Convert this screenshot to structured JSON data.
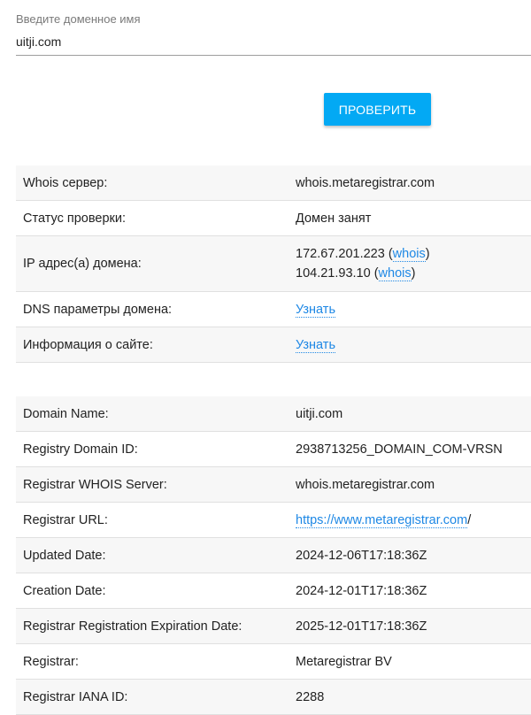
{
  "search": {
    "label": "Введите доменное имя",
    "value": "uitji.com",
    "button": "ПРОВЕРИТЬ"
  },
  "summary": {
    "whois_server_label": "Whois сервер:",
    "whois_server_value": "whois.metaregistrar.com",
    "status_label": "Статус проверки:",
    "status_value": "Домен занят",
    "ip_label": "IP адрес(а) домена:",
    "ips": [
      {
        "ip": "172.67.201.223",
        "link": "whois"
      },
      {
        "ip": "104.21.93.10",
        "link": "whois"
      }
    ],
    "dns_label": "DNS параметры домена:",
    "dns_link": "Узнать",
    "site_label": "Информация о сайте:",
    "site_link": "Узнать"
  },
  "whois": [
    {
      "key": "Domain Name:",
      "value": "uitji.com"
    },
    {
      "key": "Registry Domain ID:",
      "value": "2938713256_DOMAIN_COM-VRSN"
    },
    {
      "key": "Registrar WHOIS Server:",
      "value": "whois.metaregistrar.com"
    },
    {
      "key": "Registrar URL:",
      "value_link": "https://www.metaregistrar.com",
      "value_suffix": "/"
    },
    {
      "key": "Updated Date:",
      "value": "2024-12-06T17:18:36Z"
    },
    {
      "key": "Creation Date:",
      "value": "2024-12-01T17:18:36Z"
    },
    {
      "key": "Registrar Registration Expiration Date:",
      "value": "2025-12-01T17:18:36Z"
    },
    {
      "key": "Registrar:",
      "value": "Metaregistrar BV"
    },
    {
      "key": "Registrar IANA ID:",
      "value": "2288"
    }
  ],
  "colors": {
    "accent": "#03a9f4",
    "link": "#1e88e5",
    "row_alt": "#f7f7f7"
  }
}
